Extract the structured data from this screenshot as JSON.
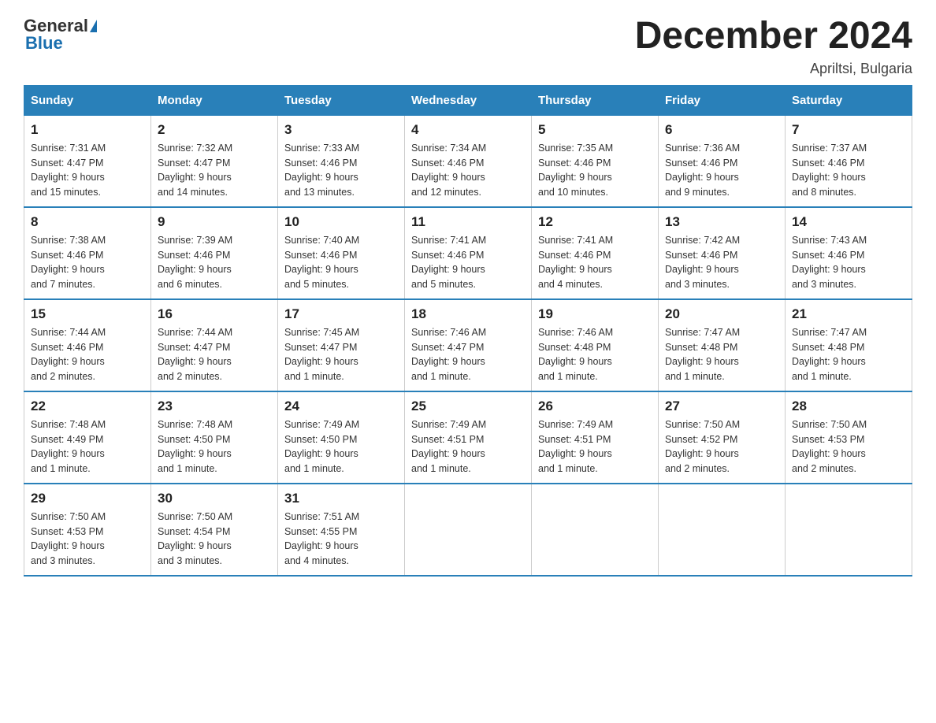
{
  "header": {
    "logo_general": "General",
    "logo_blue": "Blue",
    "month_title": "December 2024",
    "subtitle": "Apriltsi, Bulgaria"
  },
  "days_of_week": [
    "Sunday",
    "Monday",
    "Tuesday",
    "Wednesday",
    "Thursday",
    "Friday",
    "Saturday"
  ],
  "weeks": [
    [
      {
        "day": "1",
        "sunrise": "7:31 AM",
        "sunset": "4:47 PM",
        "daylight": "9 hours and 15 minutes."
      },
      {
        "day": "2",
        "sunrise": "7:32 AM",
        "sunset": "4:47 PM",
        "daylight": "9 hours and 14 minutes."
      },
      {
        "day": "3",
        "sunrise": "7:33 AM",
        "sunset": "4:46 PM",
        "daylight": "9 hours and 13 minutes."
      },
      {
        "day": "4",
        "sunrise": "7:34 AM",
        "sunset": "4:46 PM",
        "daylight": "9 hours and 12 minutes."
      },
      {
        "day": "5",
        "sunrise": "7:35 AM",
        "sunset": "4:46 PM",
        "daylight": "9 hours and 10 minutes."
      },
      {
        "day": "6",
        "sunrise": "7:36 AM",
        "sunset": "4:46 PM",
        "daylight": "9 hours and 9 minutes."
      },
      {
        "day": "7",
        "sunrise": "7:37 AM",
        "sunset": "4:46 PM",
        "daylight": "9 hours and 8 minutes."
      }
    ],
    [
      {
        "day": "8",
        "sunrise": "7:38 AM",
        "sunset": "4:46 PM",
        "daylight": "9 hours and 7 minutes."
      },
      {
        "day": "9",
        "sunrise": "7:39 AM",
        "sunset": "4:46 PM",
        "daylight": "9 hours and 6 minutes."
      },
      {
        "day": "10",
        "sunrise": "7:40 AM",
        "sunset": "4:46 PM",
        "daylight": "9 hours and 5 minutes."
      },
      {
        "day": "11",
        "sunrise": "7:41 AM",
        "sunset": "4:46 PM",
        "daylight": "9 hours and 5 minutes."
      },
      {
        "day": "12",
        "sunrise": "7:41 AM",
        "sunset": "4:46 PM",
        "daylight": "9 hours and 4 minutes."
      },
      {
        "day": "13",
        "sunrise": "7:42 AM",
        "sunset": "4:46 PM",
        "daylight": "9 hours and 3 minutes."
      },
      {
        "day": "14",
        "sunrise": "7:43 AM",
        "sunset": "4:46 PM",
        "daylight": "9 hours and 3 minutes."
      }
    ],
    [
      {
        "day": "15",
        "sunrise": "7:44 AM",
        "sunset": "4:46 PM",
        "daylight": "9 hours and 2 minutes."
      },
      {
        "day": "16",
        "sunrise": "7:44 AM",
        "sunset": "4:47 PM",
        "daylight": "9 hours and 2 minutes."
      },
      {
        "day": "17",
        "sunrise": "7:45 AM",
        "sunset": "4:47 PM",
        "daylight": "9 hours and 1 minute."
      },
      {
        "day": "18",
        "sunrise": "7:46 AM",
        "sunset": "4:47 PM",
        "daylight": "9 hours and 1 minute."
      },
      {
        "day": "19",
        "sunrise": "7:46 AM",
        "sunset": "4:48 PM",
        "daylight": "9 hours and 1 minute."
      },
      {
        "day": "20",
        "sunrise": "7:47 AM",
        "sunset": "4:48 PM",
        "daylight": "9 hours and 1 minute."
      },
      {
        "day": "21",
        "sunrise": "7:47 AM",
        "sunset": "4:48 PM",
        "daylight": "9 hours and 1 minute."
      }
    ],
    [
      {
        "day": "22",
        "sunrise": "7:48 AM",
        "sunset": "4:49 PM",
        "daylight": "9 hours and 1 minute."
      },
      {
        "day": "23",
        "sunrise": "7:48 AM",
        "sunset": "4:50 PM",
        "daylight": "9 hours and 1 minute."
      },
      {
        "day": "24",
        "sunrise": "7:49 AM",
        "sunset": "4:50 PM",
        "daylight": "9 hours and 1 minute."
      },
      {
        "day": "25",
        "sunrise": "7:49 AM",
        "sunset": "4:51 PM",
        "daylight": "9 hours and 1 minute."
      },
      {
        "day": "26",
        "sunrise": "7:49 AM",
        "sunset": "4:51 PM",
        "daylight": "9 hours and 1 minute."
      },
      {
        "day": "27",
        "sunrise": "7:50 AM",
        "sunset": "4:52 PM",
        "daylight": "9 hours and 2 minutes."
      },
      {
        "day": "28",
        "sunrise": "7:50 AM",
        "sunset": "4:53 PM",
        "daylight": "9 hours and 2 minutes."
      }
    ],
    [
      {
        "day": "29",
        "sunrise": "7:50 AM",
        "sunset": "4:53 PM",
        "daylight": "9 hours and 3 minutes."
      },
      {
        "day": "30",
        "sunrise": "7:50 AM",
        "sunset": "4:54 PM",
        "daylight": "9 hours and 3 minutes."
      },
      {
        "day": "31",
        "sunrise": "7:51 AM",
        "sunset": "4:55 PM",
        "daylight": "9 hours and 4 minutes."
      },
      null,
      null,
      null,
      null
    ]
  ],
  "labels": {
    "sunrise": "Sunrise:",
    "sunset": "Sunset:",
    "daylight": "Daylight:"
  }
}
